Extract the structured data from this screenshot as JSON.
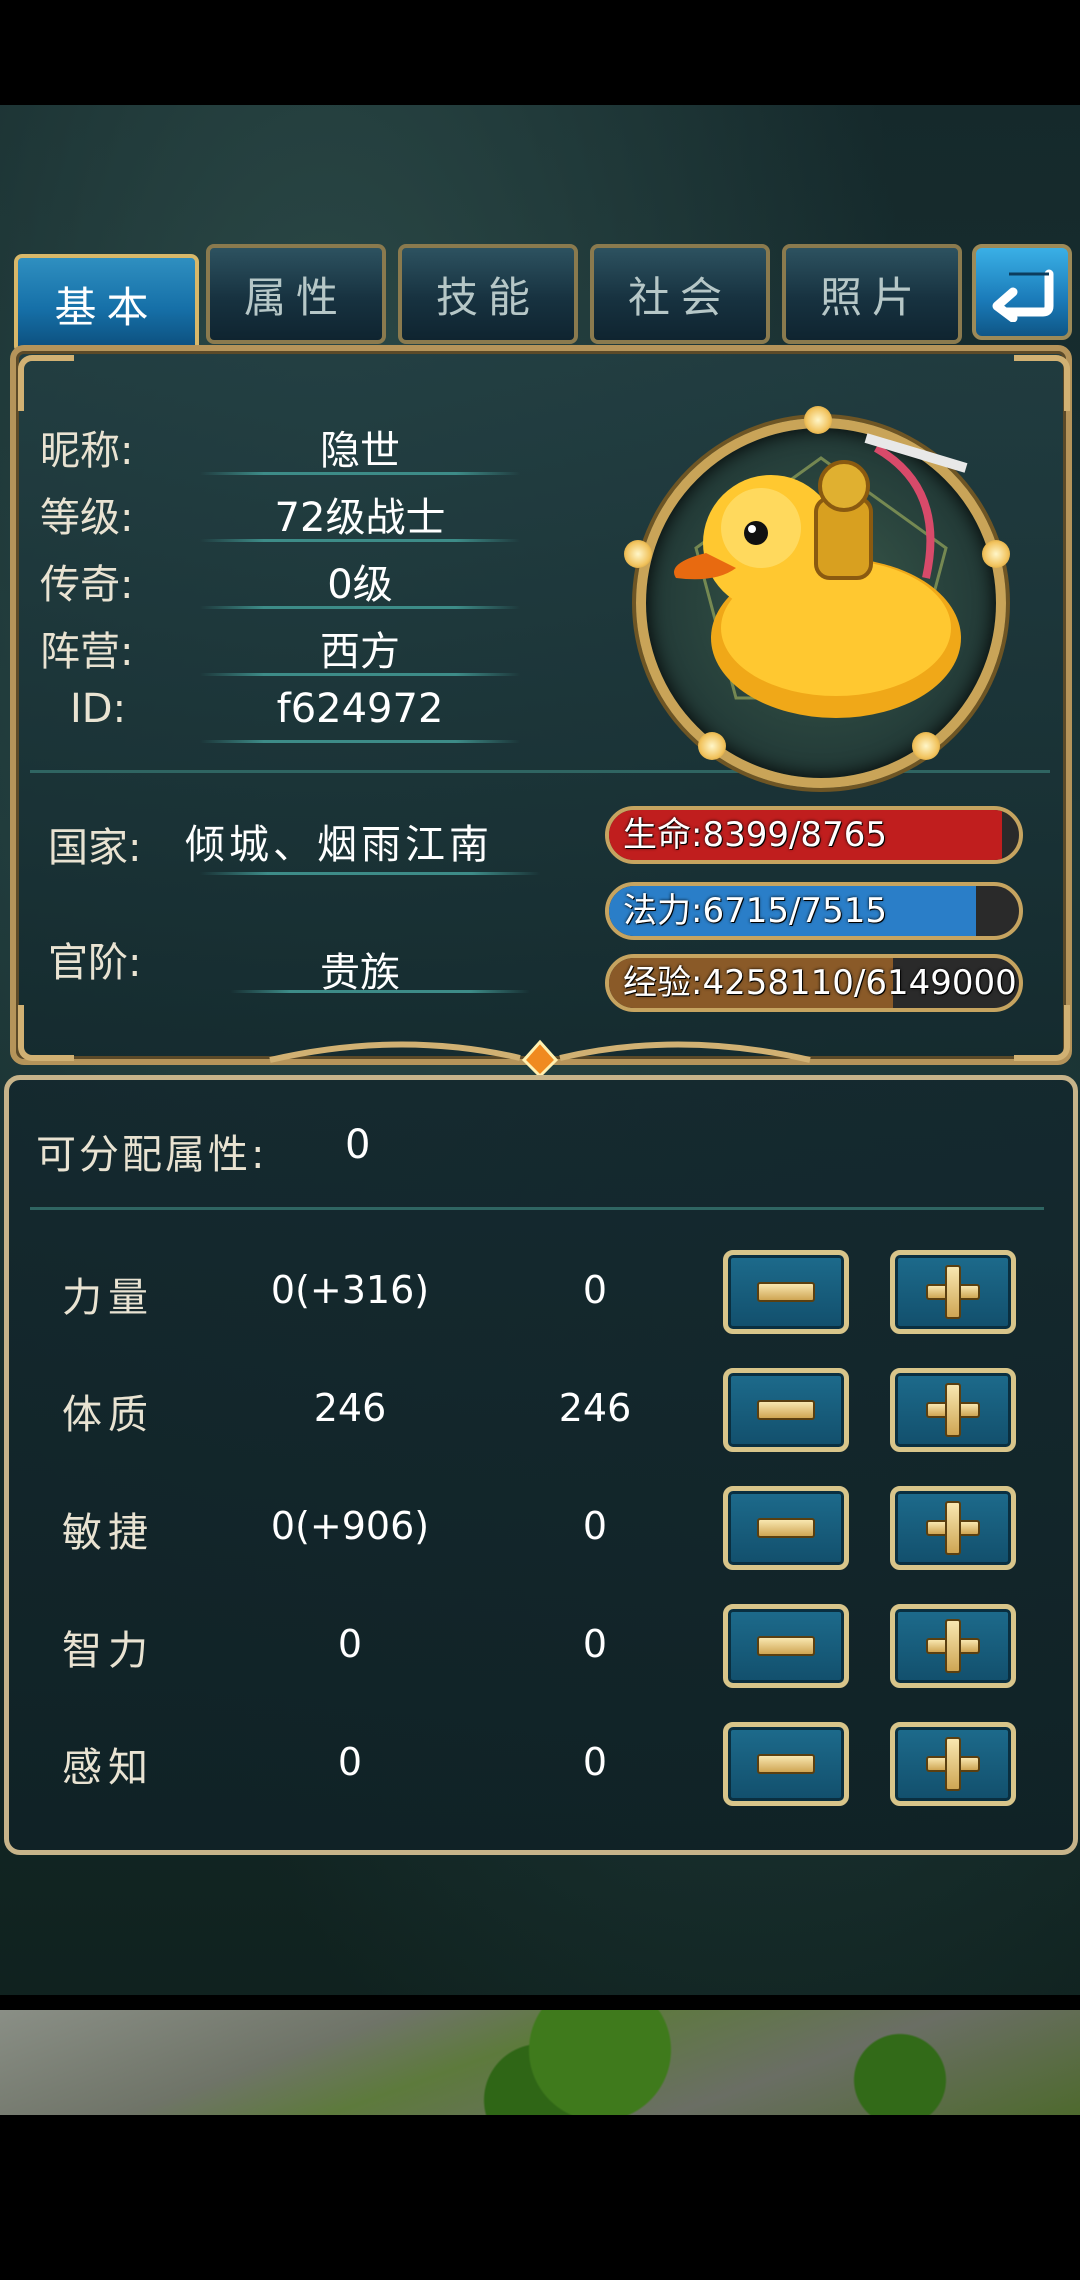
{
  "tabs": [
    {
      "label": "基本",
      "active": true
    },
    {
      "label": "属性",
      "active": false
    },
    {
      "label": "技能",
      "active": false
    },
    {
      "label": "社会",
      "active": false
    },
    {
      "label": "照片",
      "active": false
    }
  ],
  "back_icon": "back-arrow-icon",
  "profile": {
    "nickname_label": "昵称:",
    "nickname": "隐世",
    "level_label": "等级:",
    "level": "72级战士",
    "legend_label": "传奇:",
    "legend": "0级",
    "faction_label": "阵营:",
    "faction": "西方",
    "id_label": "ID:",
    "id": "f624972",
    "country_label": "国家:",
    "country": "倾城、烟雨江南",
    "rank_label": "官阶:",
    "rank": "贵族"
  },
  "bars": {
    "hp": {
      "text": "生命:8399/8765",
      "fraction": 0.958,
      "color": "#c01e1e"
    },
    "mp": {
      "text": "法力:6715/7515",
      "fraction": 0.894,
      "color": "#2a7ec8"
    },
    "exp": {
      "text": "经验:4258110/6149000",
      "fraction": 0.692,
      "color": "#8a5a28"
    }
  },
  "attributes": {
    "free_label": "可分配属性:",
    "free_value": "0",
    "rows": [
      {
        "name": "力量",
        "base": "0(+316)",
        "alloc": "0"
      },
      {
        "name": "体质",
        "base": "246",
        "alloc": "246"
      },
      {
        "name": "敏捷",
        "base": "0(+906)",
        "alloc": "0"
      },
      {
        "name": "智力",
        "base": "0",
        "alloc": "0"
      },
      {
        "name": "感知",
        "base": "0",
        "alloc": "0"
      }
    ]
  }
}
